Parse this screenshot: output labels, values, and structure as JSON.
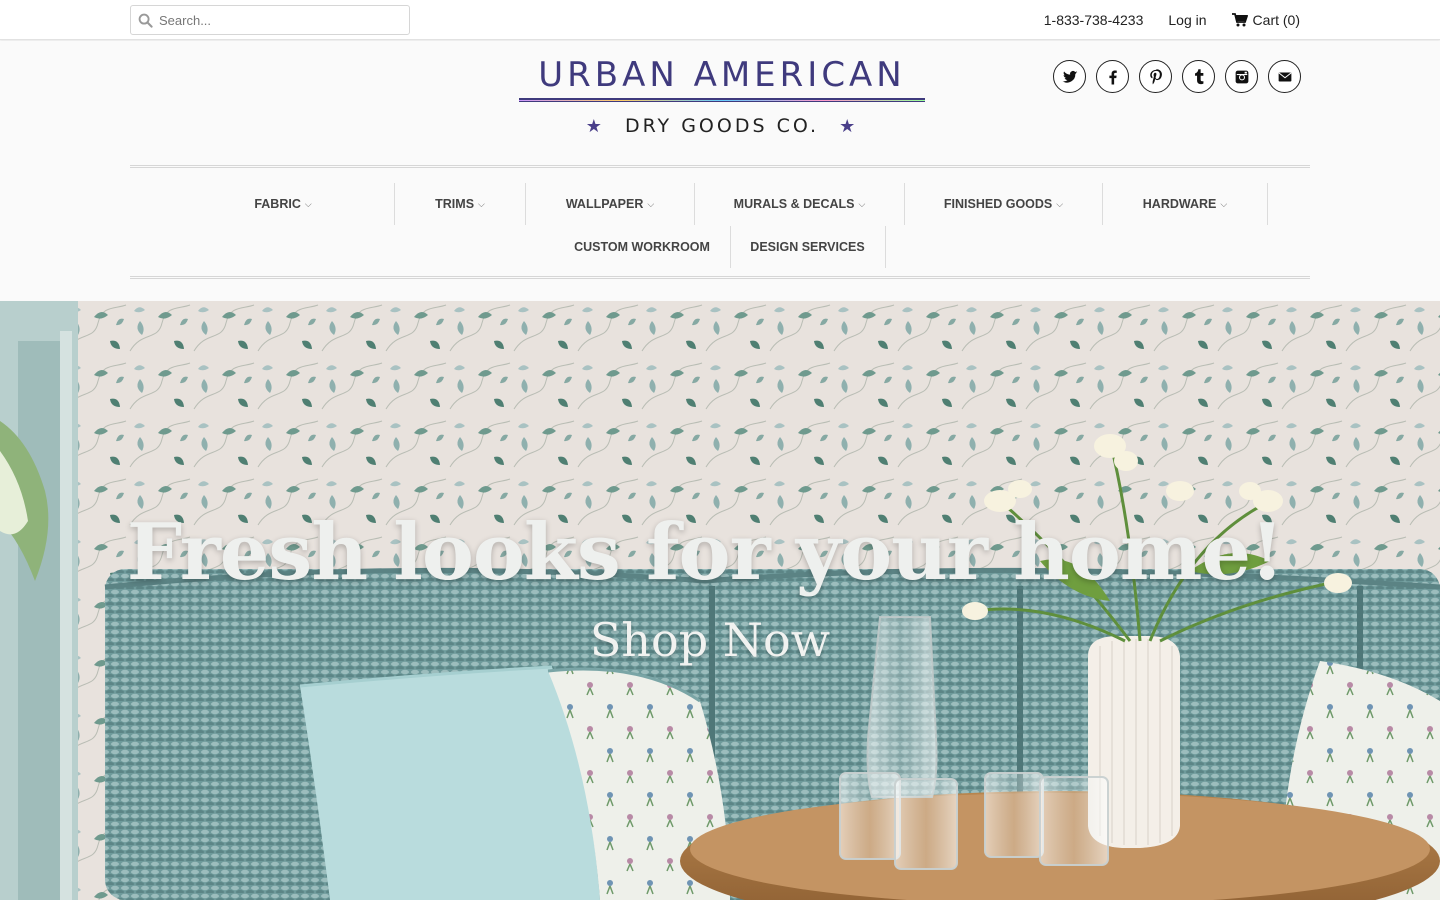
{
  "search": {
    "placeholder": "Search..."
  },
  "topbar": {
    "phone": "1-833-738-4233",
    "login_label": "Log in",
    "cart_label": "Cart (0)"
  },
  "logo": {
    "line1": "URBAN AMERICAN",
    "line2": "DRY GOODS CO."
  },
  "social": [
    {
      "name": "twitter"
    },
    {
      "name": "facebook"
    },
    {
      "name": "pinterest"
    },
    {
      "name": "tumblr"
    },
    {
      "name": "instagram"
    },
    {
      "name": "email"
    }
  ],
  "nav": {
    "row1": [
      {
        "label": "FABRIC",
        "dropdown": true
      },
      {
        "label": "TRIMS",
        "dropdown": true
      },
      {
        "label": "WALLPAPER",
        "dropdown": true
      },
      {
        "label": "MURALS & DECALS",
        "dropdown": true
      },
      {
        "label": "FINISHED GOODS",
        "dropdown": true
      },
      {
        "label": "HARDWARE",
        "dropdown": true
      }
    ],
    "row2": [
      {
        "label": "CUSTOM WORKROOM",
        "dropdown": false
      },
      {
        "label": "DESIGN SERVICES",
        "dropdown": false
      }
    ]
  },
  "hero": {
    "title": "Fresh looks for your home!",
    "cta": "Shop Now"
  },
  "colors": {
    "brand": "#3f3a7d",
    "cushion": "#7fa6a7",
    "pillow": "#b9dcdd"
  }
}
